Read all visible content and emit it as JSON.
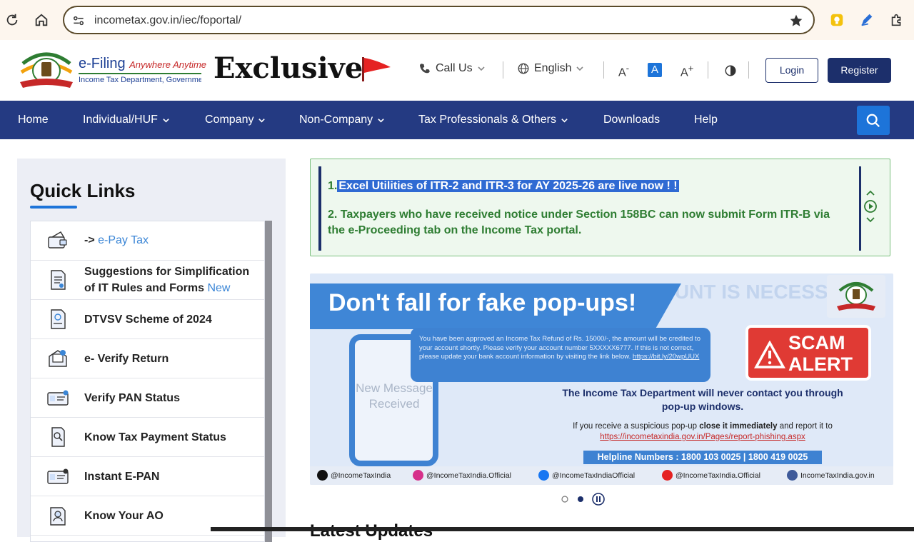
{
  "browser": {
    "url": "incometax.gov.in/iec/foportal/"
  },
  "header": {
    "brand_name": "e-Filing",
    "brand_tag": "Anywhere Anytime",
    "brand_sub": "Income Tax Department, Government of India",
    "exclusive_label": "Exclusive",
    "call_us": "Call Us",
    "language": "English",
    "font_decrease": "A",
    "font_normal": "A",
    "font_increase": "A",
    "login": "Login",
    "register": "Register"
  },
  "nav": {
    "items": [
      "Home",
      "Individual/HUF",
      "Company",
      "Non-Company",
      "Tax Professionals & Others",
      "Downloads",
      "Help"
    ]
  },
  "quick_links": {
    "title": "Quick Links",
    "items": [
      {
        "prefix": "->",
        "label": "e-Pay Tax",
        "icon": "card-icon"
      },
      {
        "label_line1": "Suggestions for Simplification",
        "label_line2": "of IT Rules and Forms",
        "badge": "New",
        "icon": "form-document-icon"
      },
      {
        "label": "DTVSV Scheme of 2024",
        "icon": "dtvsv-document-icon"
      },
      {
        "label": "e- Verify Return",
        "icon": "verify-return-icon"
      },
      {
        "label": "Verify PAN Status",
        "icon": "pan-card-icon"
      },
      {
        "label": "Know Tax Payment Status",
        "icon": "search-document-icon"
      },
      {
        "label": "Instant E-PAN",
        "icon": "epan-card-icon"
      },
      {
        "label": "Know Your AO",
        "icon": "person-search-icon"
      }
    ]
  },
  "announcements": {
    "item1_num": "1.",
    "item1": "Excel Utilities of ITR-2 and ITR-3 for AY 2025-26 are live now ! !",
    "item2": "2. Taxpayers who have received notice under Section 158BC can now submit Form ITR-B via the e-Proceeding tab on the Income Tax portal."
  },
  "banner": {
    "bg_text": "A VALIDATED BANK ACCOUNT IS NECESSARY",
    "headline": "Don't fall for fake pop-ups!",
    "phone_message": "New Message Received",
    "bubble_text": "You have been approved an Income Tax Refund of Rs. 15000/-, the amount will be credited to your account shortly. Please verify your account number 5XXXXX6777. If this is not correct, please update your bank account information by visiting the link below.",
    "bubble_link": "https://bit.ly/20wpUUX",
    "scam_line1": "SCAM",
    "scam_line2": "ALERT",
    "never_contact": "The Income Tax Department will never contact you through pop-up windows.",
    "report_prefix": "If you receive a suspicious pop-up",
    "report_bold": "close it immediately",
    "report_suffix": "and report it to",
    "report_link": "https://incometaxindia.gov.in/Pages/report-phishing.aspx",
    "helpline": "Helpline Numbers : 1800 103 0025 | 1800 419 0025",
    "socials": [
      "@IncomeTaxIndia",
      "@IncomeTaxIndia.Official",
      "@IncomeTaxIndiaOfficial",
      "@IncomeTaxIndia.Official",
      "IncomeTaxIndia.gov.in"
    ]
  },
  "latest_heading": "Latest Updates",
  "colors": {
    "nav_bg": "#243a82",
    "accent_blue": "#1d74d9",
    "announcement_green": "#2e7d32",
    "scam_red": "#e03a34"
  }
}
